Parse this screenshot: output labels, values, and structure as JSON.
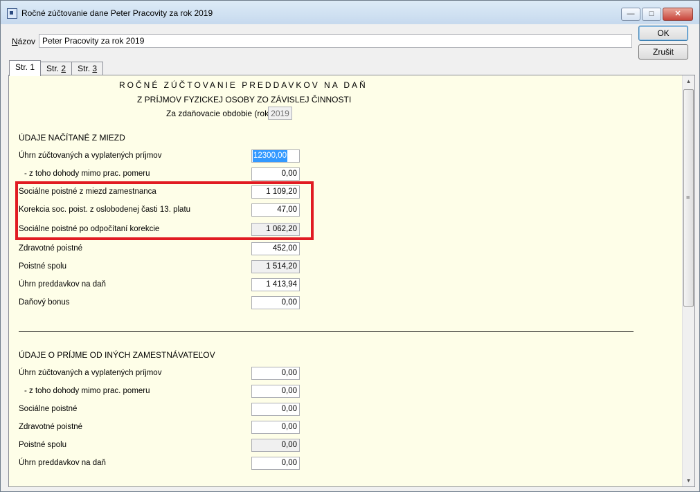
{
  "window": {
    "title": "Ročné zúčtovanie dane Peter Pracovity za rok 2019",
    "minimize": "—",
    "maximize": "□",
    "close": "✕"
  },
  "form": {
    "name_label_mnemonic": "N",
    "name_label_rest": "ázov",
    "name_value": "Peter Pracovity za rok 2019",
    "ok_label": "OK",
    "cancel_label": "Zrušit"
  },
  "tabs": [
    {
      "prefix": "Str. ",
      "num": "1"
    },
    {
      "prefix": "Str. ",
      "num": "2"
    },
    {
      "prefix": "Str. ",
      "num": "3"
    }
  ],
  "header": {
    "title": "ROČNÉ ZÚČTOVANIE PREDDAVKOV NA DAŇ",
    "subtitle": "Z PRÍJMOV FYZICKEJ OSOBY ZO ZÁVISLEJ ČINNOSTI",
    "period_label": "Za zdaňovacie obdobie (rok)",
    "period_value": "2019"
  },
  "section1": {
    "heading": "ÚDAJE NAČÍTANÉ Z MIEZD",
    "rows": [
      {
        "label": "Úhrn zúčtovaných a vyplatených príjmov",
        "value": "12300,00"
      },
      {
        "label": "- z toho dohody mimo prac. pomeru",
        "value": "0,00"
      },
      {
        "label": "Sociálne poistné z miezd zamestnanca",
        "value": "1 109,20"
      },
      {
        "label": "Korekcia soc. poist. z oslobodenej časti 13. platu",
        "value": "47,00"
      },
      {
        "label": "Sociálne poistné po odpočítaní korekcie",
        "value": "1 062,20"
      },
      {
        "label": "Zdravotné poistné",
        "value": "452,00"
      },
      {
        "label": "Poistné spolu",
        "value": "1 514,20"
      },
      {
        "label": "Úhrn preddavkov na daň",
        "value": "1 413,94"
      },
      {
        "label": "Daňový bonus",
        "value": "0,00"
      }
    ]
  },
  "section2": {
    "heading": "ÚDAJE O PRÍJME OD INÝCH ZAMESTNÁVATEĽOV",
    "rows": [
      {
        "label": "Úhrn zúčtovaných a vyplatených príjmov",
        "value": "0,00"
      },
      {
        "label": "- z toho dohody mimo prac. pomeru",
        "value": "0,00"
      },
      {
        "label": "Sociálne poistné",
        "value": "0,00"
      },
      {
        "label": "Zdravotné poistné",
        "value": "0,00"
      },
      {
        "label": "Poistné spolu",
        "value": "0,00"
      },
      {
        "label": "Úhrn preddavkov na daň",
        "value": "0,00"
      }
    ]
  },
  "colors": {
    "panel_bg": "#fefee8",
    "highlight": "#e11b22",
    "selection": "#3399ff"
  }
}
